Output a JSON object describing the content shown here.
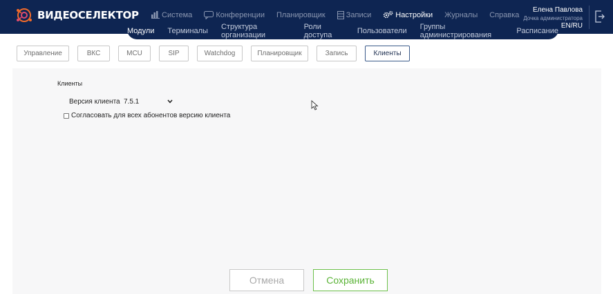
{
  "app": {
    "logo_text": "ВИДЕОСЕЛЕКТОР",
    "brand_colors": {
      "navbar": "#0e2552",
      "logo_accent": "#f26b2a",
      "save_green": "#5ab336"
    }
  },
  "main_nav": [
    {
      "label": "Система",
      "icon": "bar-chart-icon"
    },
    {
      "label": "Конференции",
      "icon": "chat-bubble-icon"
    },
    {
      "label": "Планировщик",
      "icon": ""
    },
    {
      "label": "Записи",
      "icon": "film-strip-icon"
    },
    {
      "label": "Настройки",
      "icon": "gears-icon",
      "active": true
    },
    {
      "label": "Журналы",
      "icon": ""
    },
    {
      "label": "Справка",
      "icon": ""
    }
  ],
  "user": {
    "name": "Елена Павлова",
    "role": "Дочка администратора",
    "lang": "EN/RU"
  },
  "sub_nav": [
    {
      "label": "Модули",
      "active": true
    },
    {
      "label": "Терминалы"
    },
    {
      "label": "Структура организации"
    },
    {
      "label": "Роли доступа"
    },
    {
      "label": "Пользователи"
    },
    {
      "label": "Группы администрирования"
    },
    {
      "label": "Расписание"
    }
  ],
  "tabs": [
    {
      "label": "Управление"
    },
    {
      "label": "ВКС"
    },
    {
      "label": "MCU"
    },
    {
      "label": "SIP"
    },
    {
      "label": "Watchdog"
    },
    {
      "label": "Планировщик"
    },
    {
      "label": "Запись"
    },
    {
      "label": "Клиенты",
      "active": true
    }
  ],
  "clients": {
    "section_title": "Клиенты",
    "version_label": "Версия клиента",
    "version_value": "7.5.1",
    "sync_checkbox_label": "Согласовать для всех абонентов версию клиента",
    "sync_checked": false
  },
  "actions": {
    "cancel_label": "Отмена",
    "save_label": "Сохранить"
  }
}
